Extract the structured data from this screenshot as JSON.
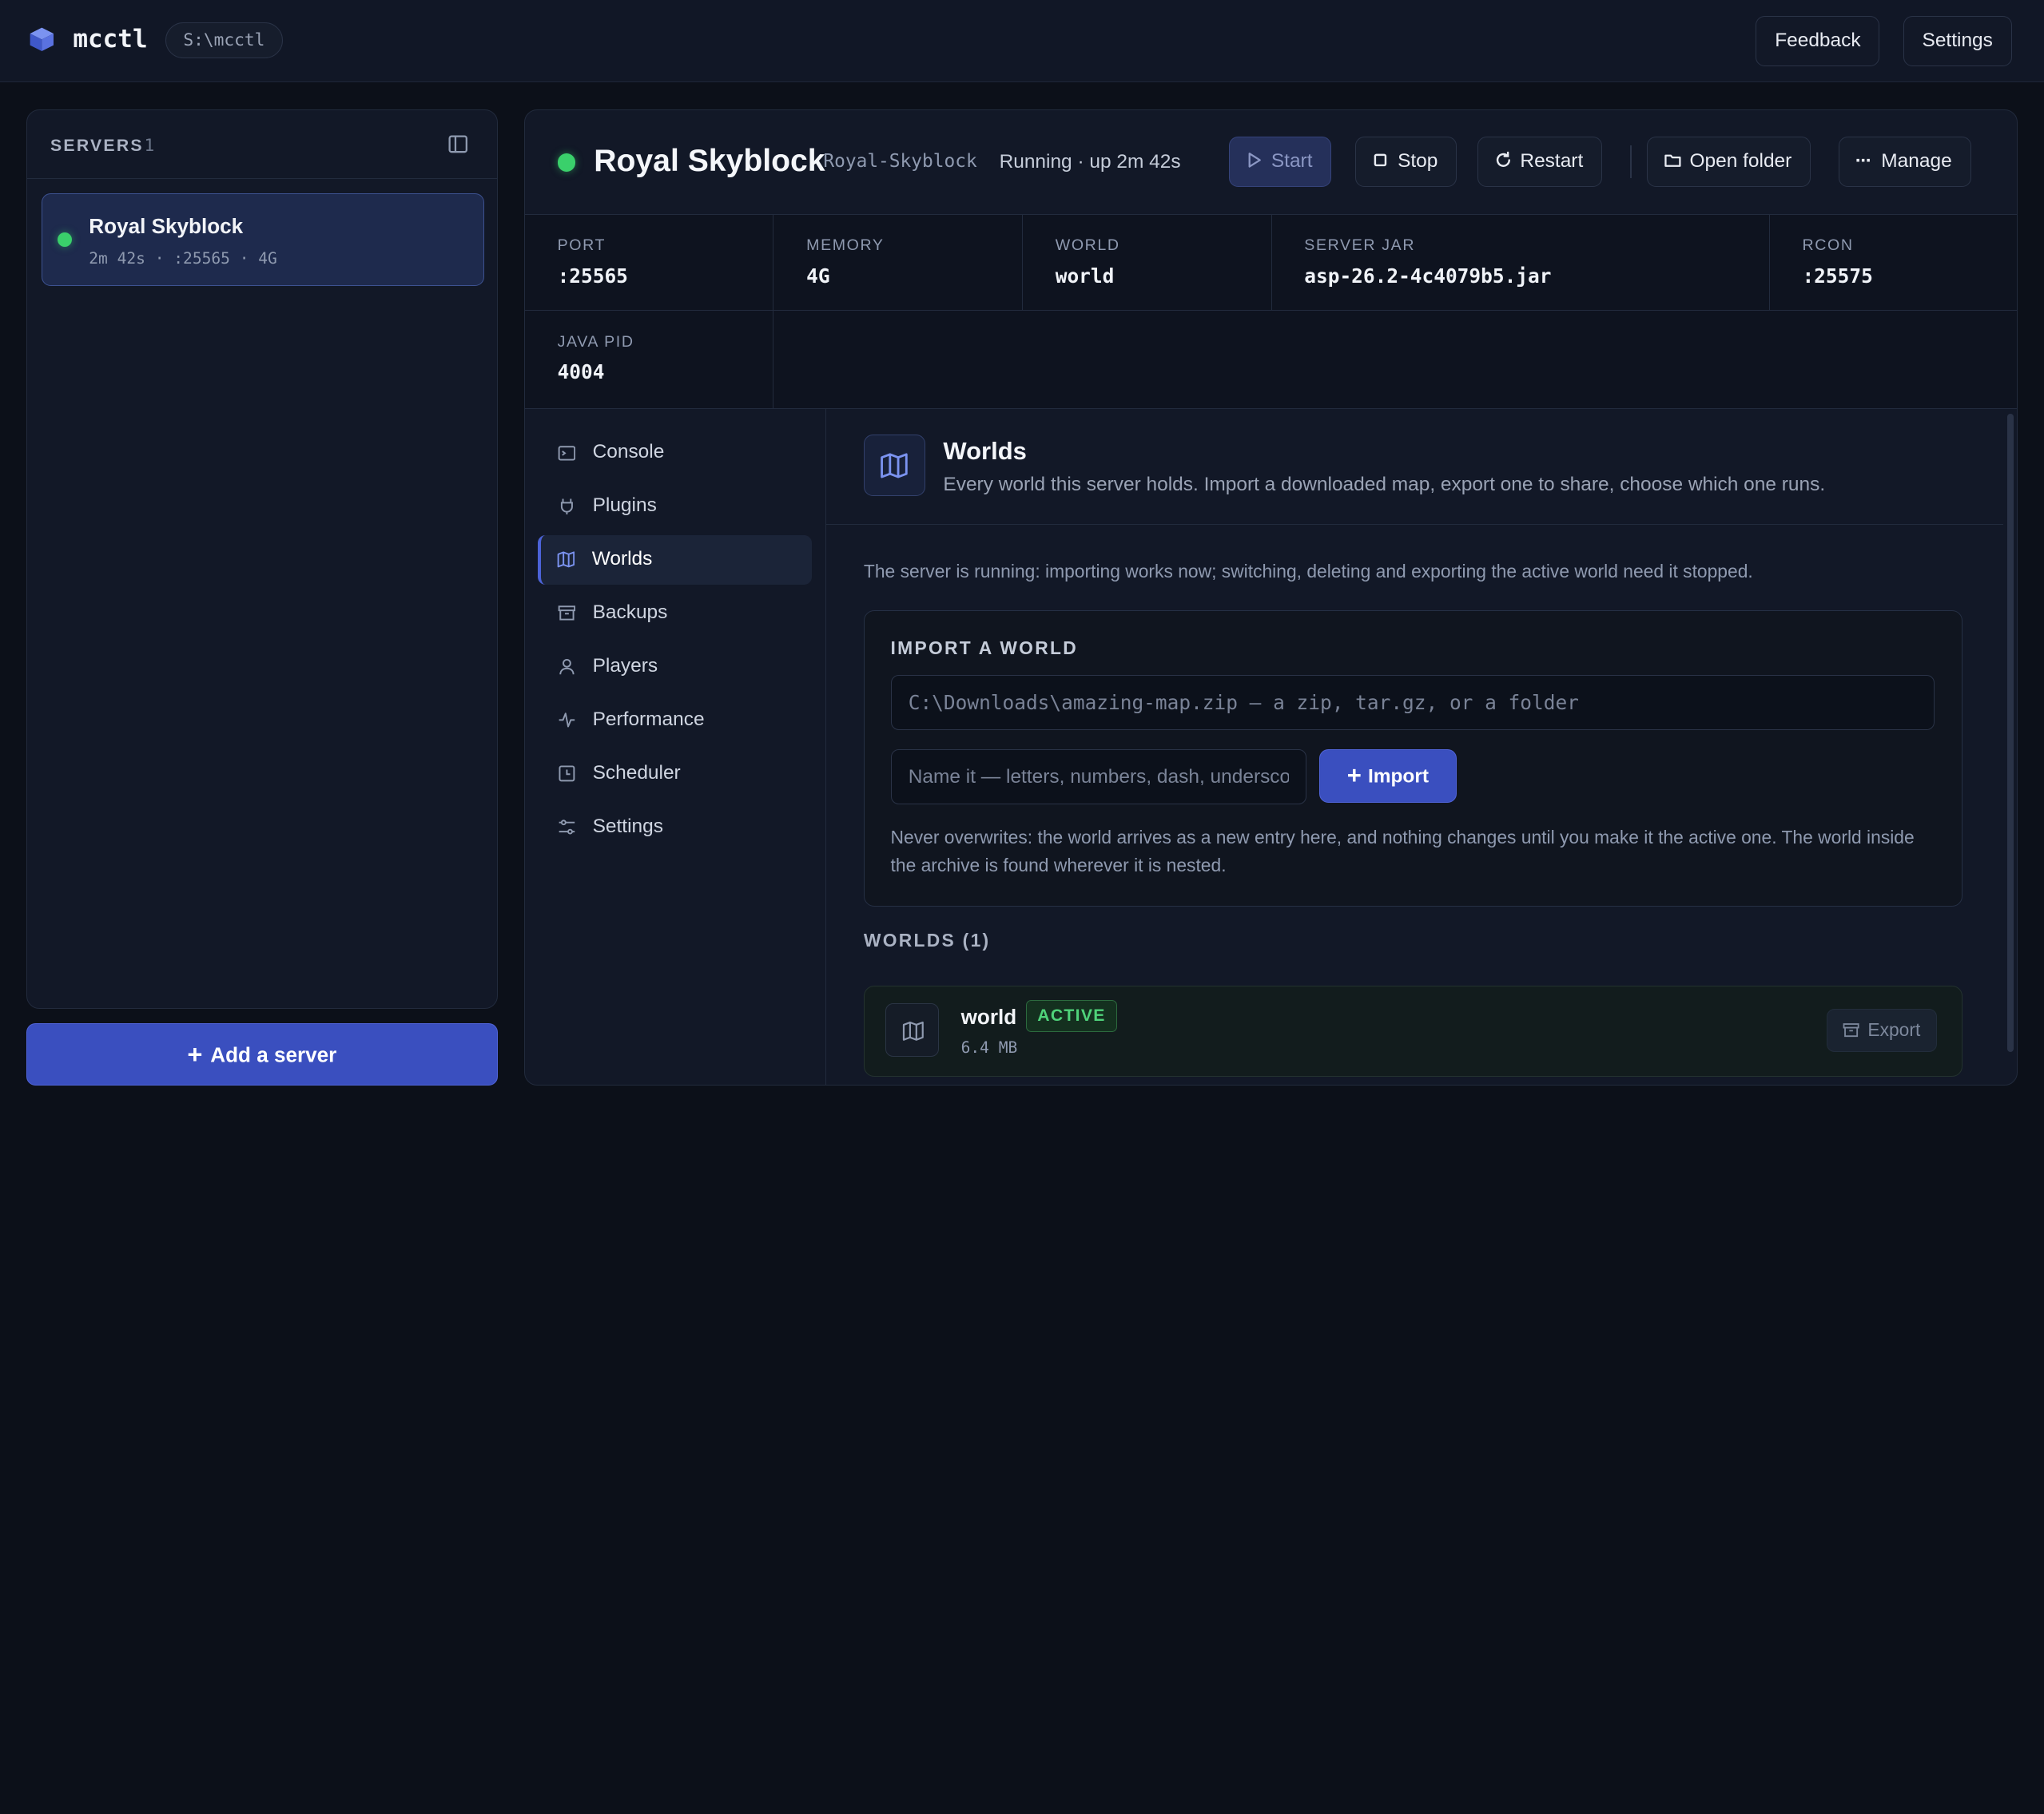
{
  "app": {
    "name": "mcctl",
    "path": "S:\\mcctl"
  },
  "topbar": {
    "feedback_label": "Feedback",
    "settings_label": "Settings"
  },
  "sidebar": {
    "heading": "SERVERS",
    "count": "1",
    "servers": [
      {
        "name": "Royal Skyblock",
        "meta": "2m 42s · :25565 · 4G",
        "status": "running"
      }
    ],
    "add_label": "Add a server"
  },
  "server": {
    "title": "Royal Skyblock",
    "slug": "Royal-Skyblock",
    "status_text": "Running · up 2m 42s",
    "actions": {
      "start": "Start",
      "stop": "Stop",
      "restart": "Restart",
      "open_folder": "Open folder",
      "manage": "Manage"
    },
    "stats": [
      {
        "label": "PORT",
        "value": ":25565"
      },
      {
        "label": "MEMORY",
        "value": "4G"
      },
      {
        "label": "WORLD",
        "value": "world"
      },
      {
        "label": "SERVER JAR",
        "value": "asp-26.2-4c4079b5.jar"
      },
      {
        "label": "RCON",
        "value": ":25575"
      },
      {
        "label": "JAVA PID",
        "value": "4004"
      }
    ]
  },
  "nav": [
    {
      "label": "Console",
      "icon": "terminal-icon"
    },
    {
      "label": "Plugins",
      "icon": "plug-icon"
    },
    {
      "label": "Worlds",
      "icon": "map-icon",
      "active": true
    },
    {
      "label": "Backups",
      "icon": "archive-icon"
    },
    {
      "label": "Players",
      "icon": "user-icon"
    },
    {
      "label": "Performance",
      "icon": "activity-icon"
    },
    {
      "label": "Scheduler",
      "icon": "clock-icon"
    },
    {
      "label": "Settings",
      "icon": "sliders-icon"
    }
  ],
  "worlds": {
    "title": "Worlds",
    "subtitle": "Every world this server holds. Import a downloaded map, export one to share, choose which one runs.",
    "notice": "The server is running: importing works now; switching, deleting and exporting the active world need it stopped.",
    "import": {
      "heading": "IMPORT A WORLD",
      "path_placeholder": "C:\\Downloads\\amazing-map.zip — a zip, tar.gz, or a folder",
      "name_placeholder": "Name it — letters, numbers, dash, underscore",
      "button_label": "Import",
      "help": "Never overwrites: the world arrives as a new entry here, and nothing changes until you make it the active one. The world inside the archive is found wherever it is nested."
    },
    "list_heading": "WORLDS (1)",
    "items": [
      {
        "name": "world",
        "badge": "ACTIVE",
        "size": "6.4 MB",
        "export_label": "Export"
      }
    ]
  },
  "colors": {
    "accent": "#3a4fbf",
    "running": "#3ad06b",
    "background": "#0c1019",
    "panel": "#121827"
  }
}
